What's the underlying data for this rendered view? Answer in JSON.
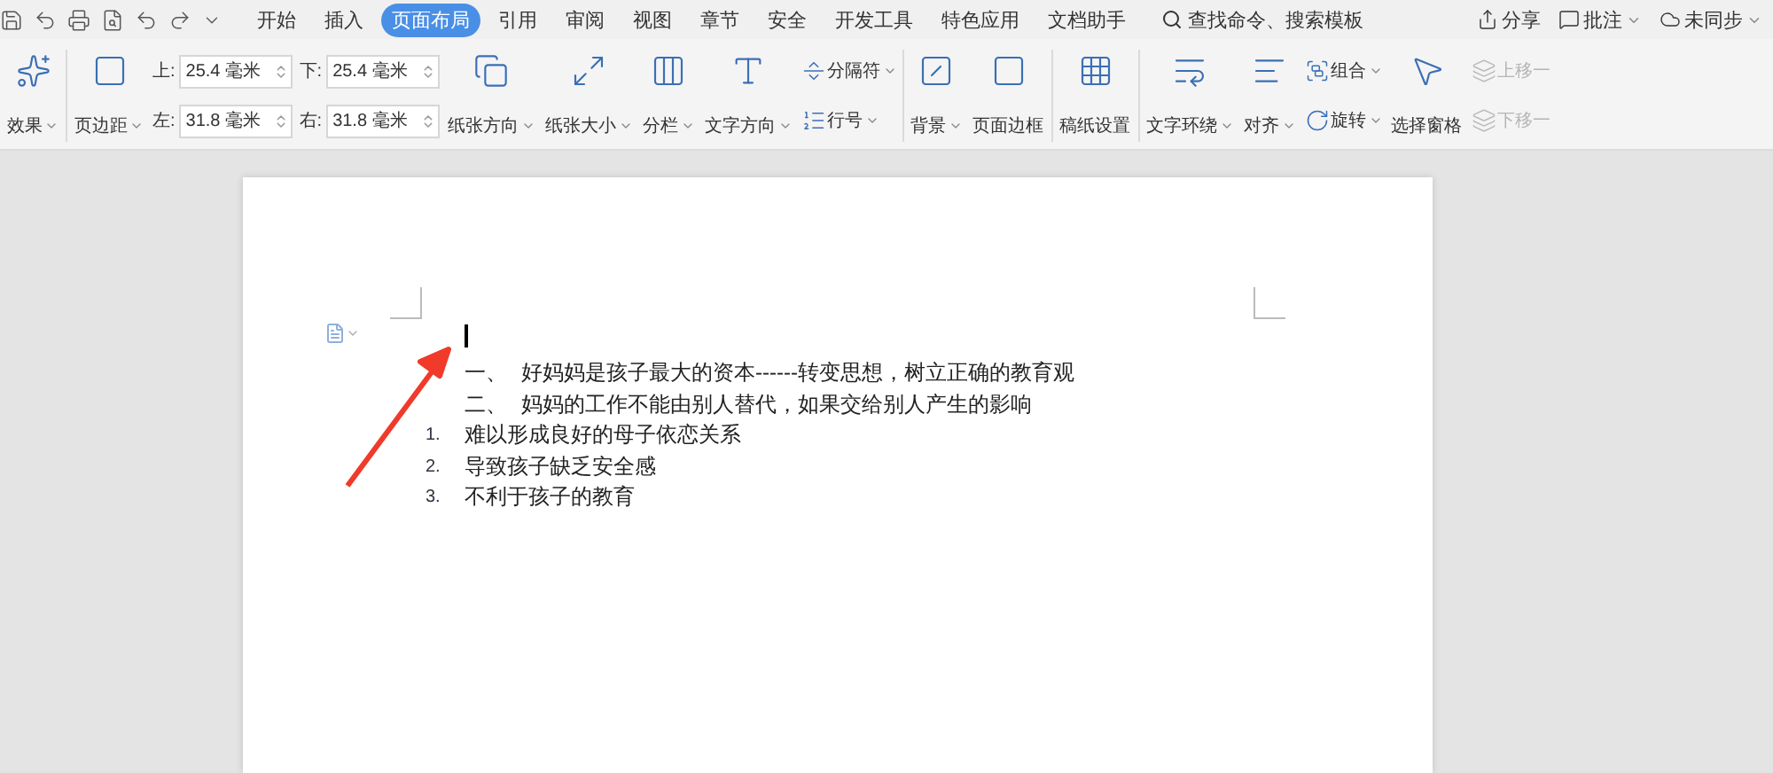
{
  "tabs": [
    {
      "label": "开始",
      "selected": false
    },
    {
      "label": "插入",
      "selected": false
    },
    {
      "label": "页面布局",
      "selected": true
    },
    {
      "label": "引用",
      "selected": false
    },
    {
      "label": "审阅",
      "selected": false
    },
    {
      "label": "视图",
      "selected": false
    },
    {
      "label": "章节",
      "selected": false
    },
    {
      "label": "安全",
      "selected": false
    },
    {
      "label": "开发工具",
      "selected": false
    },
    {
      "label": "特色应用",
      "selected": false
    },
    {
      "label": "文档助手",
      "selected": false
    }
  ],
  "search": {
    "placeholder": "查找命令、搜索模板"
  },
  "top_actions": [
    {
      "label": "分享",
      "dropdown": false
    },
    {
      "label": "批注",
      "dropdown": true
    },
    {
      "label": "未同步",
      "dropdown": true
    }
  ],
  "ribbon": [
    {
      "columns": [
        {
          "kind": "large",
          "label": "效果",
          "dropdown": true,
          "disabled": false
        }
      ]
    },
    {
      "columns": [
        {
          "kind": "large",
          "label": "页边距",
          "dropdown": true,
          "disabled": false
        },
        {
          "kind": "fields",
          "fields": [
            {
              "label": "上:",
              "value": "25.4 毫米"
            },
            {
              "label": "左:",
              "value": "31.8 毫米"
            }
          ]
        },
        {
          "kind": "fields",
          "fields": [
            {
              "label": "下:",
              "value": "25.4 毫米"
            },
            {
              "label": "右:",
              "value": "31.8 毫米"
            }
          ]
        },
        {
          "kind": "large",
          "label": "纸张方向",
          "dropdown": true,
          "disabled": false
        },
        {
          "kind": "large",
          "label": "纸张大小",
          "dropdown": true,
          "disabled": false
        },
        {
          "kind": "large",
          "label": "分栏",
          "dropdown": true,
          "disabled": false
        },
        {
          "kind": "large",
          "label": "文字方向",
          "dropdown": true,
          "disabled": false
        },
        {
          "kind": "stack",
          "buttons": [
            {
              "label": "分隔符",
              "dropdown": true,
              "disabled": false
            },
            {
              "label": "行号",
              "dropdown": true,
              "disabled": false
            }
          ]
        }
      ]
    },
    {
      "columns": [
        {
          "kind": "large",
          "label": "背景",
          "dropdown": true,
          "disabled": false
        },
        {
          "kind": "large",
          "label": "页面边框",
          "dropdown": false,
          "disabled": false
        }
      ]
    },
    {
      "columns": [
        {
          "kind": "large",
          "label": "稿纸设置",
          "dropdown": false,
          "disabled": false
        }
      ]
    },
    {
      "columns": [
        {
          "kind": "large",
          "label": "文字环绕",
          "dropdown": true,
          "disabled": false
        },
        {
          "kind": "large",
          "label": "对齐",
          "dropdown": true,
          "disabled": false
        },
        {
          "kind": "stack",
          "buttons": [
            {
              "label": "组合",
              "dropdown": true,
              "disabled": false
            },
            {
              "label": "旋转",
              "dropdown": true,
              "disabled": false
            }
          ]
        },
        {
          "kind": "large",
          "label": "选择窗格",
          "dropdown": false,
          "disabled": false
        },
        {
          "kind": "stack",
          "buttons": [
            {
              "label": "上移一",
              "dropdown": false,
              "disabled": true
            },
            {
              "label": "下移一",
              "dropdown": false,
              "disabled": true
            }
          ]
        }
      ]
    }
  ],
  "document": {
    "lines": [
      {
        "kind": "heading",
        "marker": "一、",
        "text": "好妈妈是孩子最大的资本------转变思想，树立正确的教育观"
      },
      {
        "kind": "heading",
        "marker": "二、",
        "text": "妈妈的工作不能由别人替代，如果交给别人产生的影响"
      },
      {
        "kind": "numbered",
        "marker": "1.",
        "text": "难以形成良好的母子依恋关系"
      },
      {
        "kind": "numbered",
        "marker": "2.",
        "text": "导致孩子缺乏安全感"
      },
      {
        "kind": "numbered",
        "marker": "3.",
        "text": "不利于孩子的教育"
      }
    ]
  }
}
